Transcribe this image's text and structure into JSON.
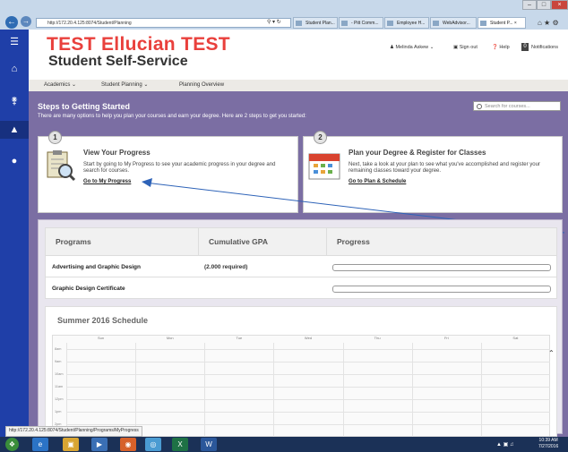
{
  "browser": {
    "url": "http://172.20.4.125:8074/Student/Planning",
    "tabs": [
      "Student Plan...",
      "- Pitt Comm...",
      "Employee H...",
      "WebAdvisor...",
      "Student P..."
    ],
    "status_url": "http://172.20.4.125:8074/Student/Planning/Programs/MyProgress"
  },
  "header": {
    "brand_line1": "TEST Ellucian TEST",
    "brand_line2": "Student Self-Service",
    "user": "Melinda Askew",
    "sign_out": "Sign out",
    "help": "Help",
    "notifications_count": "0",
    "notifications": "Notifications"
  },
  "breadcrumb": [
    "Academics",
    "Student Planning",
    "Planning Overview"
  ],
  "main": {
    "title": "Steps to Getting Started",
    "subtitle": "There are many options to help you plan your courses and earn your degree. Here are 2 steps to get you started:",
    "search_placeholder": "Search for courses..."
  },
  "steps": [
    {
      "num": "1",
      "title": "View Your Progress",
      "text": "Start by going to My Progress to see your academic progress in your degree and search for courses.",
      "link": "Go to My Progress"
    },
    {
      "num": "2",
      "title": "Plan your Degree & Register for Classes",
      "text": "Next, take a look at your plan to see what you've accomplished and register your remaining classes toward your degree.",
      "link": "Go to Plan & Schedule"
    }
  ],
  "programs_table": {
    "headers": [
      "Programs",
      "Cumulative GPA",
      "Progress"
    ],
    "rows": [
      {
        "program": "Advertising and Graphic Design",
        "gpa": "(2.000 required)"
      },
      {
        "program": "Graphic Design Certificate",
        "gpa": ""
      }
    ]
  },
  "schedule": {
    "title": "Summer 2016 Schedule",
    "days": [
      "Sun",
      "Mon",
      "Tue",
      "Wed",
      "Thu",
      "Fri",
      "Sat"
    ],
    "times": [
      "8am",
      "9am",
      "10am",
      "11am",
      "12pm",
      "1pm",
      "2pm"
    ]
  },
  "clock": {
    "time": "10:39 AM",
    "date": "7/27/2016"
  },
  "colors": {
    "brand_red": "#e9403c",
    "sidebar": "#1f3fa8",
    "content_purple": "#7b6ea3"
  }
}
